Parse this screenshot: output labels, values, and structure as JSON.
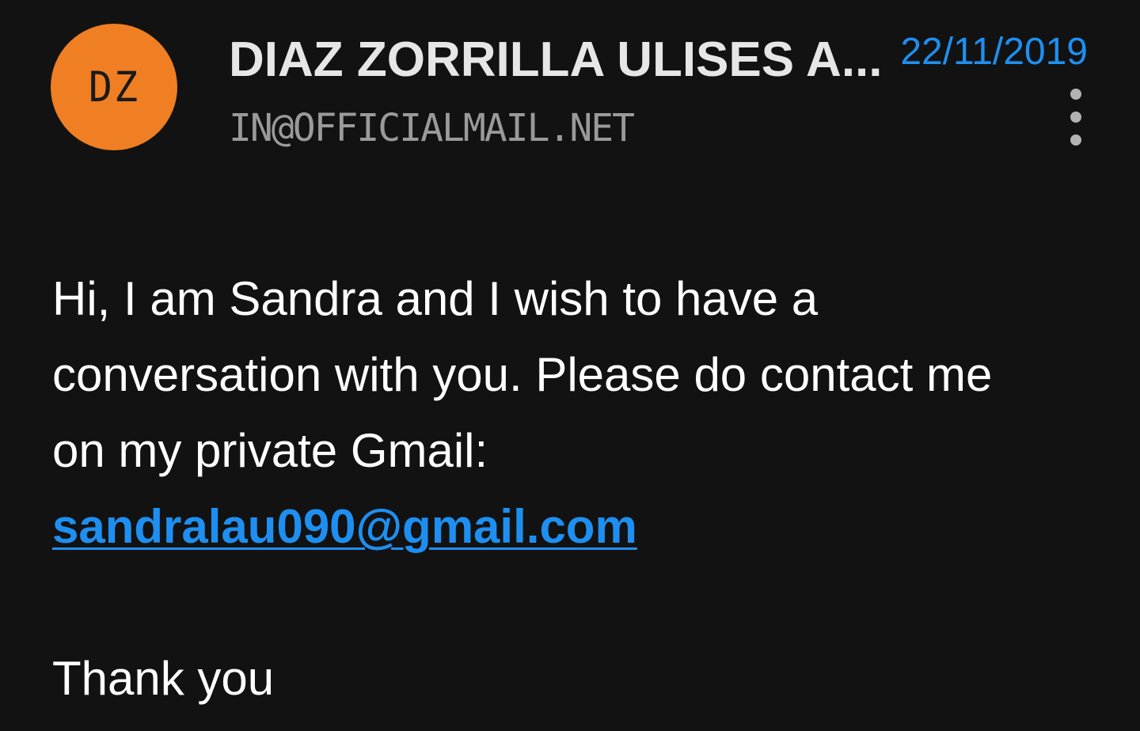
{
  "colors": {
    "avatar_bg": "#f07f23",
    "accent": "#1e8ff0",
    "background": "#121212"
  },
  "header": {
    "avatar_initials": "DZ",
    "sender_name": "DIAZ ZORRILLA ULISES A...",
    "sender_email": "IN@OFFICIALMAIL.NET",
    "date": "22/11/2019",
    "more_icon": "more-vert-icon"
  },
  "message": {
    "line1": "Hi, I am Sandra and I wish to have a",
    "line2": "conversation with you. Please do contact me",
    "line3": "on my private Gmail:",
    "email_link": "sandralau090@gmail.com",
    "closing": "Thank you"
  }
}
